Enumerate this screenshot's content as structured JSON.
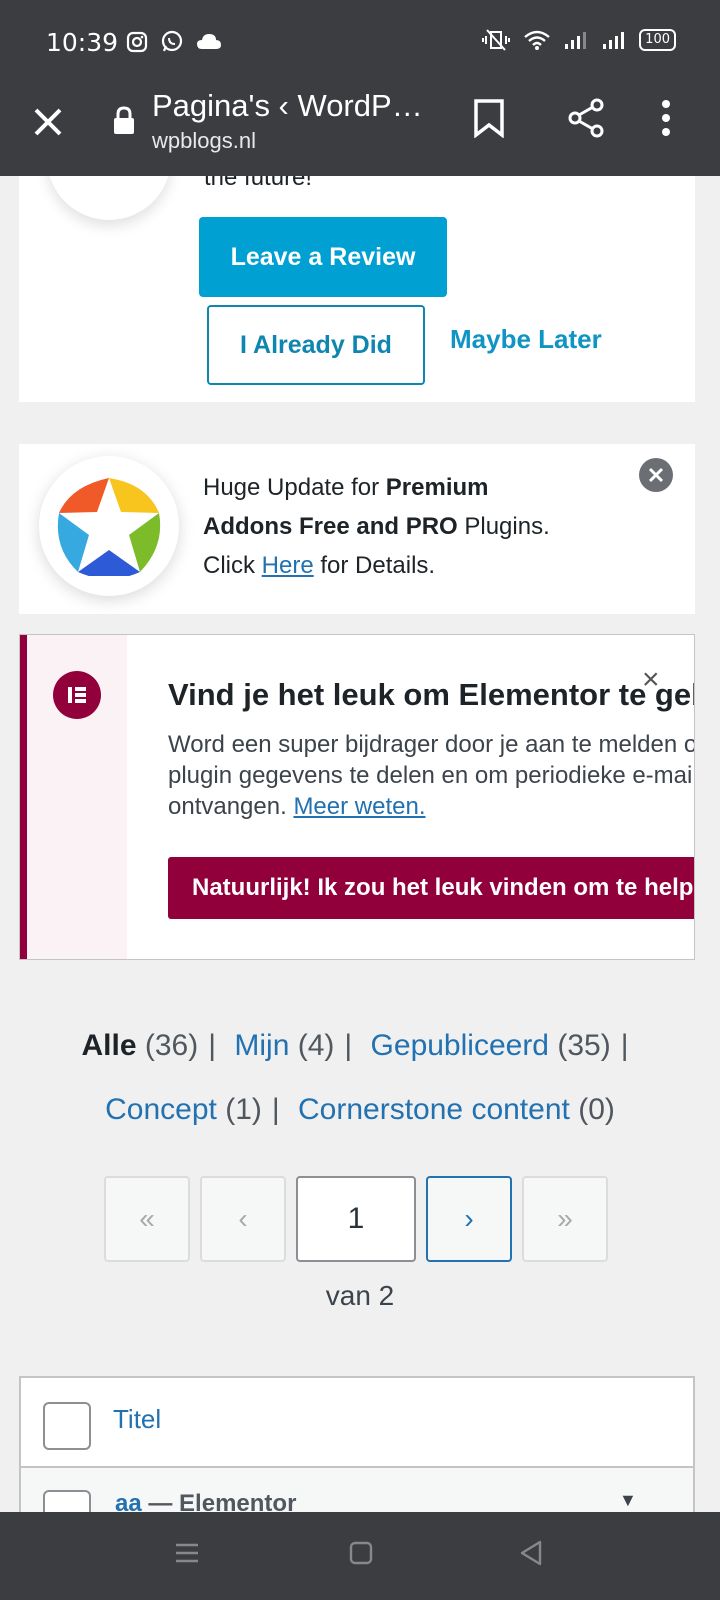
{
  "status_bar": {
    "time": "10:39",
    "battery": "100"
  },
  "browser": {
    "title": "Pagina's ‹ WordPr…",
    "url": "wpblogs.nl"
  },
  "review_notice": {
    "snippet": "the future!",
    "leave_review": "Leave a Review",
    "already_did": "I Already Did",
    "maybe_later": "Maybe Later"
  },
  "premium_notice": {
    "t1": "Huge Update for ",
    "t2": "Premium Addons Free and PRO",
    "t3": " Plugins. Click ",
    "link": "Here",
    "t4": " for Details."
  },
  "elementor_notice": {
    "title": "Vind je het leuk om Elementor te gebruiken?",
    "line1": "Word een super bijdrager door je aan te melden om",
    "line2": "plugin gegevens te delen en om periodieke e-mails te",
    "line3_prefix": "ontvangen. ",
    "learn_more": "Meer weten.",
    "cta": "Natuurlijk! Ik zou het leuk vinden om te helpen",
    "close": "×"
  },
  "filters": {
    "all_label": "Alle",
    "all_count": "(36)",
    "mine_label": "Mijn",
    "mine_count": "(4)",
    "published_label": "Gepubliceerd",
    "published_count": "(35)",
    "draft_label": "Concept",
    "draft_count": "(1)",
    "cornerstone_label": "Cornerstone content",
    "cornerstone_count": "(0)"
  },
  "pagination": {
    "first": "«",
    "prev": "‹",
    "current": "1",
    "next": "›",
    "last": "»",
    "of_pages": "van 2"
  },
  "table": {
    "header_title": "Titel",
    "rows": [
      {
        "title": "aa",
        "state": " — Elementor"
      }
    ]
  },
  "colors": {
    "wp_blue": "#2271b1",
    "elementor": "#92003b",
    "review_blue": "#00a0d2"
  }
}
